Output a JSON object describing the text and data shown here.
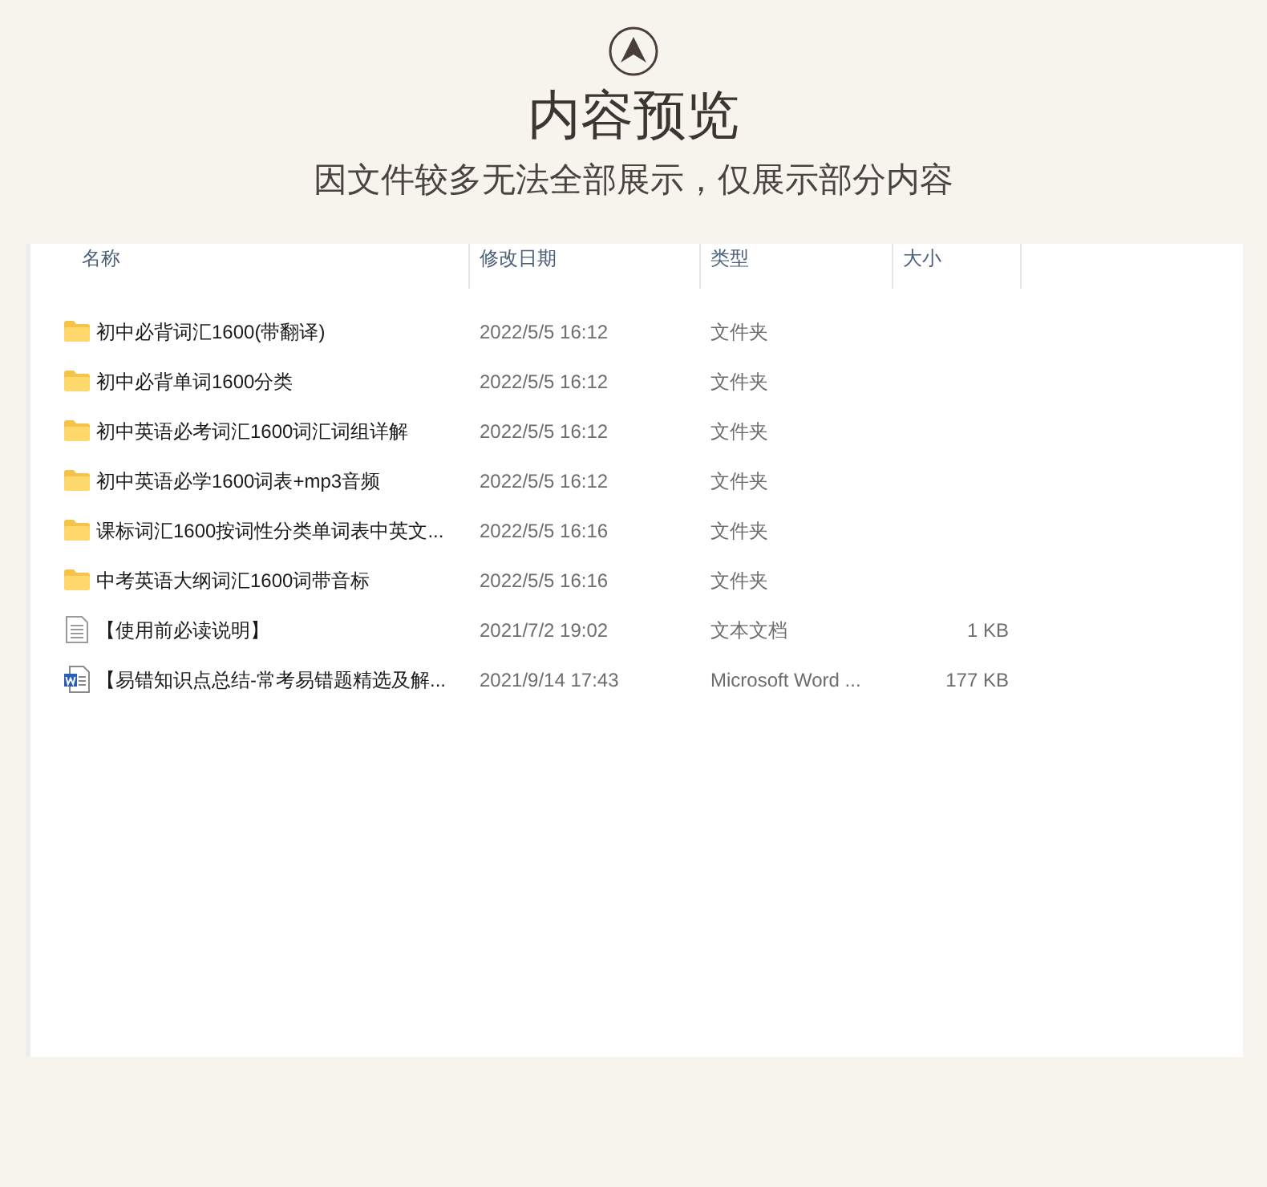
{
  "header": {
    "title": "内容预览",
    "subtitle": "因文件较多无法全部展示，仅展示部分内容"
  },
  "table": {
    "columns": [
      "名称",
      "修改日期",
      "类型",
      "大小"
    ],
    "rows": [
      {
        "kind": "folder",
        "name": "初中必背词汇1600(带翻译)",
        "date": "2022/5/5 16:12",
        "type": "文件夹"
      },
      {
        "kind": "folder",
        "name": "初中必背单词1600分类",
        "date": "2022/5/5 16:12",
        "type": "文件夹"
      },
      {
        "kind": "folder",
        "name": "初中英语必考词汇1600词汇词组详解",
        "date": "2022/5/5 16:12",
        "type": "文件夹"
      },
      {
        "kind": "folder",
        "name": "初中英语必学1600词表+mp3音频",
        "date": "2022/5/5 16:12",
        "type": "文件夹"
      },
      {
        "kind": "folder",
        "name": "课标词汇1600按词性分类单词表中英文...",
        "date": "2022/5/5 16:16",
        "type": "文件夹"
      },
      {
        "kind": "folder",
        "name": "中考英语大纲词汇1600词带音标",
        "date": "2022/5/5 16:16",
        "type": "文件夹"
      },
      {
        "kind": "text",
        "name": "【使用前必读说明】",
        "date": "2021/7/2 19:02",
        "type": "文本文档",
        "size": "1 KB"
      },
      {
        "kind": "word",
        "name": "【易错知识点总结-常考易错题精选及解...",
        "date": "2021/9/14 17:43",
        "type": "Microsoft Word ...",
        "size": "177 KB"
      }
    ]
  }
}
